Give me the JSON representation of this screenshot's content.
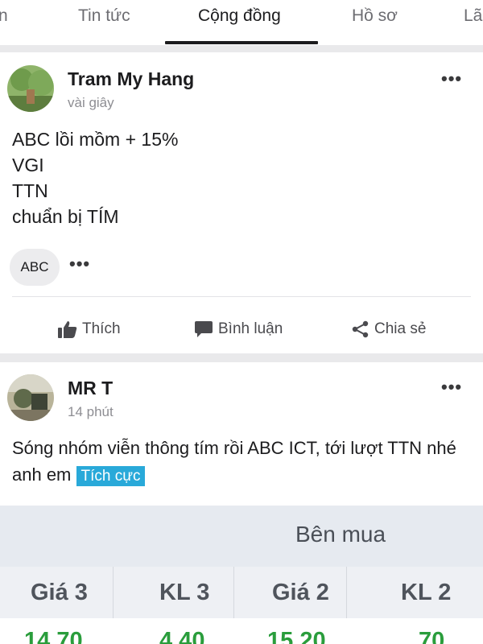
{
  "tabs": [
    {
      "label": "n",
      "active": false
    },
    {
      "label": "Tin tức",
      "active": false
    },
    {
      "label": "Cộng đồng",
      "active": true
    },
    {
      "label": "Hồ sơ",
      "active": false
    },
    {
      "label": "Lã",
      "active": false
    }
  ],
  "post1": {
    "author": "Tram My Hang",
    "time": "vài giây",
    "lines": [
      "ABC lồi mồm + 15%",
      "VGI",
      "TTN",
      "chuẩn bị TÍM"
    ],
    "tag": "ABC",
    "more": "•••",
    "actions": {
      "like": "Thích",
      "comment": "Bình luận",
      "share": "Chia sẻ"
    }
  },
  "post2": {
    "author": "MR T",
    "time": "14 phút",
    "text": "Sóng nhóm viễn thông tím rồi ABC ICT, tới lượt TTN nhé anh em",
    "badge": "Tích cực",
    "more": "•••",
    "embed": {
      "title": "Bên mua",
      "columns": [
        "Giá 3",
        "KL 3",
        "Giá 2",
        "KL 2"
      ],
      "row": [
        "14.70",
        "4.40",
        "15.20",
        "70"
      ]
    }
  },
  "colors": {
    "badge": "#29a9d9",
    "price_green": "#2a9d3c"
  }
}
